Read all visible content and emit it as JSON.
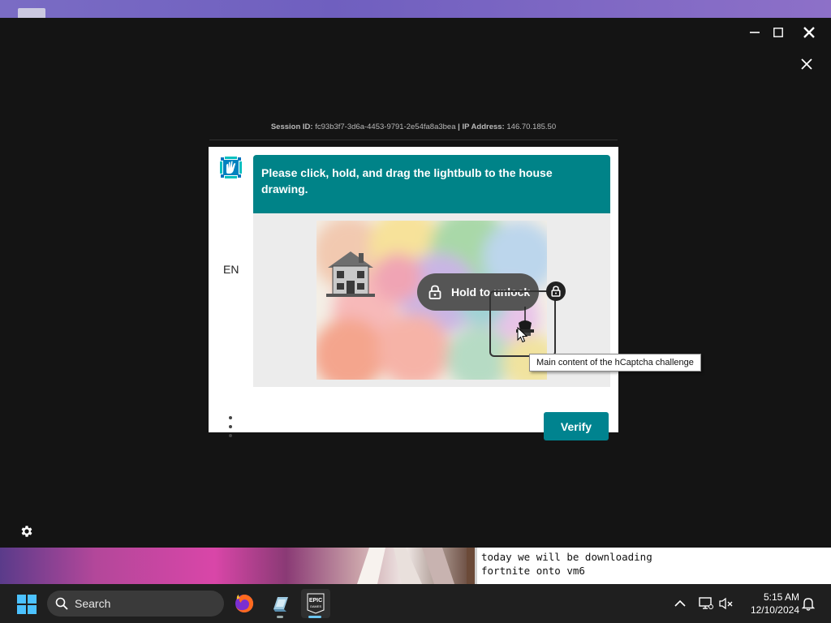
{
  "window": {
    "minimize_icon": "minimize-icon",
    "maximize_icon": "maximize-icon",
    "close_icon": "close-icon"
  },
  "overlay": {
    "close_icon": "close-icon"
  },
  "session": {
    "id_label": "Session ID:",
    "id_value": "fc93b3f7-3d6a-4453-9791-2e54fa8a3bea",
    "separator": "|",
    "ip_label": "IP Address:",
    "ip_value": "146.70.185.50"
  },
  "captcha": {
    "logo_icon": "hcaptcha-hand-icon",
    "language": "EN",
    "prompt": "Please click, hold, and drag the lightbulb to the house drawing.",
    "hold_label": "Hold to unlock",
    "tooltip": "Main content of the hCaptcha challenge",
    "verify_label": "Verify",
    "colors": {
      "prompt_bg": "#008388",
      "verify_bg": "#00838f",
      "pill_bg": "#555555"
    }
  },
  "settings_icon": "gear-icon",
  "stream_note": {
    "line1": "today we will be downloading",
    "line2": "fortnite onto vm6"
  },
  "taskbar": {
    "start_icon": "windows-start-icon",
    "search_placeholder": "Search",
    "apps": [
      {
        "name": "Firefox",
        "icon": "firefox-icon"
      },
      {
        "name": "App",
        "icon": "app-icon"
      },
      {
        "name": "Epic Games",
        "icon": "epic-games-icon",
        "glyph_top": "EPIC",
        "glyph_bottom": "GAMES"
      }
    ],
    "tray": {
      "chevron_icon": "chevron-up-icon",
      "display_icon": "display-icon",
      "volume_icon": "volume-muted-icon",
      "notification_icon": "bell-icon"
    },
    "time": "5:15 AM",
    "date": "12/10/2024"
  }
}
